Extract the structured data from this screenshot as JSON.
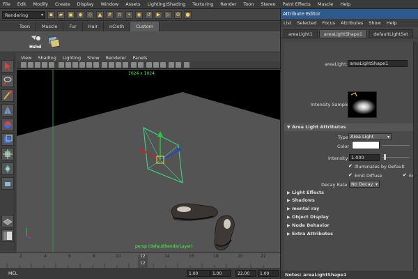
{
  "menubar": [
    "File",
    "Edit",
    "Modify",
    "Create",
    "Display",
    "Window",
    "Assets",
    "Lighting/Shading",
    "Texturing",
    "Render",
    "Toon",
    "Stereo",
    "Paint Effects",
    "Muscle",
    "Help"
  ],
  "statusline": {
    "mode": "Rendering"
  },
  "shelf": {
    "tabs": [
      "Toon",
      "Muscle",
      "Fur",
      "Hair",
      "nCloth",
      "Custom"
    ],
    "active_tab": "Custom",
    "icon_label": "Hshd"
  },
  "panel": {
    "menu": [
      "View",
      "Shading",
      "Lighting",
      "Show",
      "Renderer",
      "Panels"
    ]
  },
  "viewport": {
    "resolution": "1024 x 1024",
    "camera": "persp (defaultRenderLayer)"
  },
  "timeline": {
    "ticks": [
      "2",
      "4",
      "6",
      "8",
      "10",
      "12",
      "14",
      "16",
      "18",
      "20",
      "22"
    ],
    "current_frame": "12"
  },
  "rangebar": {
    "mel_label": "MEL",
    "start": "1.00",
    "min": "1.00",
    "max": "22.00",
    "end": "1.00"
  },
  "attribute_editor": {
    "title": "Attribute Editor",
    "menu": [
      "List",
      "Selected",
      "Focus",
      "Attributes",
      "Show",
      "Help"
    ],
    "tabs": [
      "areaLight1",
      "areaLightShape1",
      "defaultLightSet"
    ],
    "active_tab": "areaLightShape1",
    "node_label": "areaLight:",
    "node_value": "areaLightShape1",
    "intensity_sample_label": "Intensity Sample",
    "section_open": "Area Light Attributes",
    "type_label": "Type",
    "type_value": "Area Light",
    "color_label": "Color",
    "color_value": "#ffffff",
    "intensity_label": "Intensity",
    "intensity_value": "1.000",
    "illuminates_label": "Illuminates by Default",
    "emit_diffuse_label": "Emit Diffuse",
    "emit_specular_label": "Em",
    "decay_label": "Decay Rate",
    "decay_value": "No Decay",
    "sections_closed": [
      "Light Effects",
      "Shadows",
      "mental ray",
      "Object Display",
      "Node Behavior",
      "Extra Attributes"
    ],
    "notes": "Notes: areaLightShape1"
  }
}
